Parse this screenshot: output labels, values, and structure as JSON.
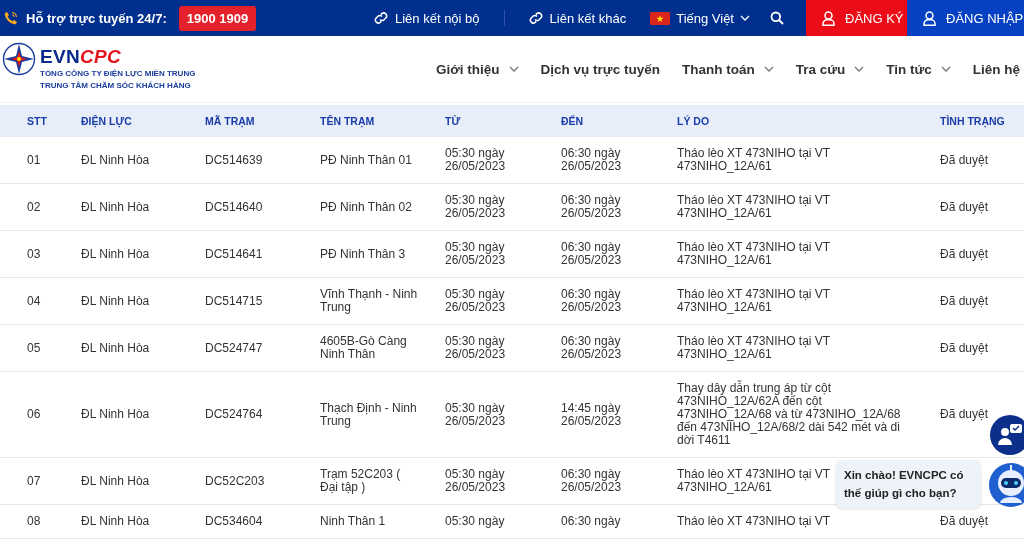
{
  "topbar": {
    "hotline_label": "Hỗ trợ trực tuyến 24/7:",
    "hotline_number": "1900 1909",
    "links": [
      "Liên kết nội bộ",
      "Liên kết khác"
    ],
    "language": "Tiếng Việt",
    "register": "ĐĂNG KÝ",
    "login": "ĐĂNG NHẬP"
  },
  "header": {
    "logo": {
      "brand_main": "EVN",
      "brand_accent": "CPC",
      "line1": "TỔNG CÔNG TY ĐIỆN LỰC MIỀN TRUNG",
      "line2": "TRUNG TÂM CHĂM SÓC KHÁCH HÀNG"
    },
    "nav": [
      {
        "label": "Giới thiệu",
        "has_dropdown": true
      },
      {
        "label": "Dịch vụ trực tuyến",
        "has_dropdown": false
      },
      {
        "label": "Thanh toán",
        "has_dropdown": true
      },
      {
        "label": "Tra cứu",
        "has_dropdown": true
      },
      {
        "label": "Tin tức",
        "has_dropdown": true
      },
      {
        "label": "Liên hệ",
        "has_dropdown": false
      }
    ]
  },
  "table": {
    "columns": [
      "STT",
      "ĐIỆN LỰC",
      "MÃ TRẠM",
      "TÊN TRẠM",
      "TỪ",
      "ĐẾN",
      "LÝ DO",
      "TÌNH TRẠNG"
    ],
    "rows": [
      {
        "stt": "01",
        "unit": "ĐL Ninh Hòa",
        "code": "DC514639",
        "name": "PĐ Ninh Thân 01",
        "from": "05:30 ngày 26/05/2023",
        "to": "06:30 ngày 26/05/2023",
        "reason": "Tháo lèo XT 473NIHO tại VT 473NIHO_12A/61",
        "status": "Đã duyệt"
      },
      {
        "stt": "02",
        "unit": "ĐL Ninh Hòa",
        "code": "DC514640",
        "name": "PĐ Ninh Thân 02",
        "from": "05:30 ngày 26/05/2023",
        "to": "06:30 ngày 26/05/2023",
        "reason": "Tháo lèo XT 473NIHO tại VT 473NIHO_12A/61",
        "status": "Đã duyệt"
      },
      {
        "stt": "03",
        "unit": "ĐL Ninh Hòa",
        "code": "DC514641",
        "name": "PĐ Ninh Thân 3",
        "from": "05:30 ngày 26/05/2023",
        "to": "06:30 ngày 26/05/2023",
        "reason": "Tháo lèo XT 473NIHO tại VT 473NIHO_12A/61",
        "status": "Đã duyệt"
      },
      {
        "stt": "04",
        "unit": "ĐL Ninh Hòa",
        "code": "DC514715",
        "name": "Vĩnh Thạnh - Ninh Trung",
        "from": "05:30 ngày 26/05/2023",
        "to": "06:30 ngày 26/05/2023",
        "reason": "Tháo lèo XT 473NIHO tại VT 473NIHO_12A/61",
        "status": "Đã duyệt"
      },
      {
        "stt": "05",
        "unit": "ĐL Ninh Hòa",
        "code": "DC524747",
        "name": "4605B-Gò Càng Ninh Thân",
        "from": "05:30 ngày 26/05/2023",
        "to": "06:30 ngày 26/05/2023",
        "reason": "Tháo lèo XT 473NIHO tại VT 473NIHO_12A/61",
        "status": "Đã duyệt"
      },
      {
        "stt": "06",
        "unit": "ĐL Ninh Hòa",
        "code": "DC524764",
        "name": "Thạch Định - Ninh Trung",
        "from": "05:30 ngày 26/05/2023",
        "to": "14:45 ngày 26/05/2023",
        "reason": "Thay dây dẫn trung áp từ cột 473NIHO_12A/62A đến cột 473NIHO_12A/68 và từ 473NIHO_12A/68 đến 473NIHO_12A/68/2 dài 542 mét và di dời T4611",
        "status": "Đã duyệt"
      },
      {
        "stt": "07",
        "unit": "ĐL Ninh Hòa",
        "code": "DC52C203",
        "name": "Trạm 52C203 ( Đại tập )",
        "from": "05:30 ngày 26/05/2023",
        "to": "06:30 ngày 26/05/2023",
        "reason": "Tháo lèo XT 473NIHO tại VT 473NIHO_12A/61"
      },
      {
        "stt": "08",
        "unit": "ĐL Ninh Hòa",
        "code": "DC534604",
        "name": "Ninh Thân 1",
        "from": "05:30 ngày",
        "to": "06:30 ngày",
        "reason": "Tháo lèo XT 473NIHO tại VT",
        "status": "Đã duyệt"
      }
    ]
  },
  "chat": {
    "greeting": "Xin chào! EVNCPC có thế giúp gì cho bạn?"
  }
}
